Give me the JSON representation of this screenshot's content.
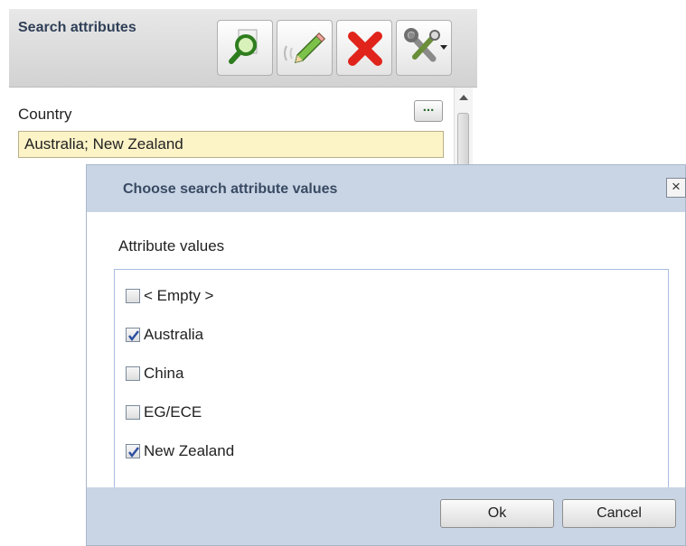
{
  "panel": {
    "title": "Search attributes",
    "toolbar": [
      {
        "icon": "search-icon"
      },
      {
        "icon": "edit-pencil-icon"
      },
      {
        "icon": "clear-x-icon"
      },
      {
        "icon": "tools-icon"
      }
    ],
    "country_label": "Country",
    "more_label": "...",
    "country_value": "Australia; New Zealand"
  },
  "dialog": {
    "title": "Choose search attribute values",
    "close_label": "×",
    "values_label": "Attribute values",
    "options": [
      {
        "label": "< Empty >",
        "checked": false
      },
      {
        "label": "Australia",
        "checked": true
      },
      {
        "label": "China",
        "checked": false
      },
      {
        "label": "EG/ECE",
        "checked": false
      },
      {
        "label": "New Zealand",
        "checked": true
      }
    ],
    "ok_label": "Ok",
    "cancel_label": "Cancel"
  },
  "colors": {
    "input_highlight": "#fcf3c6",
    "dialog_bg": "#c9d5e5",
    "clear_red": "#e0241b"
  }
}
